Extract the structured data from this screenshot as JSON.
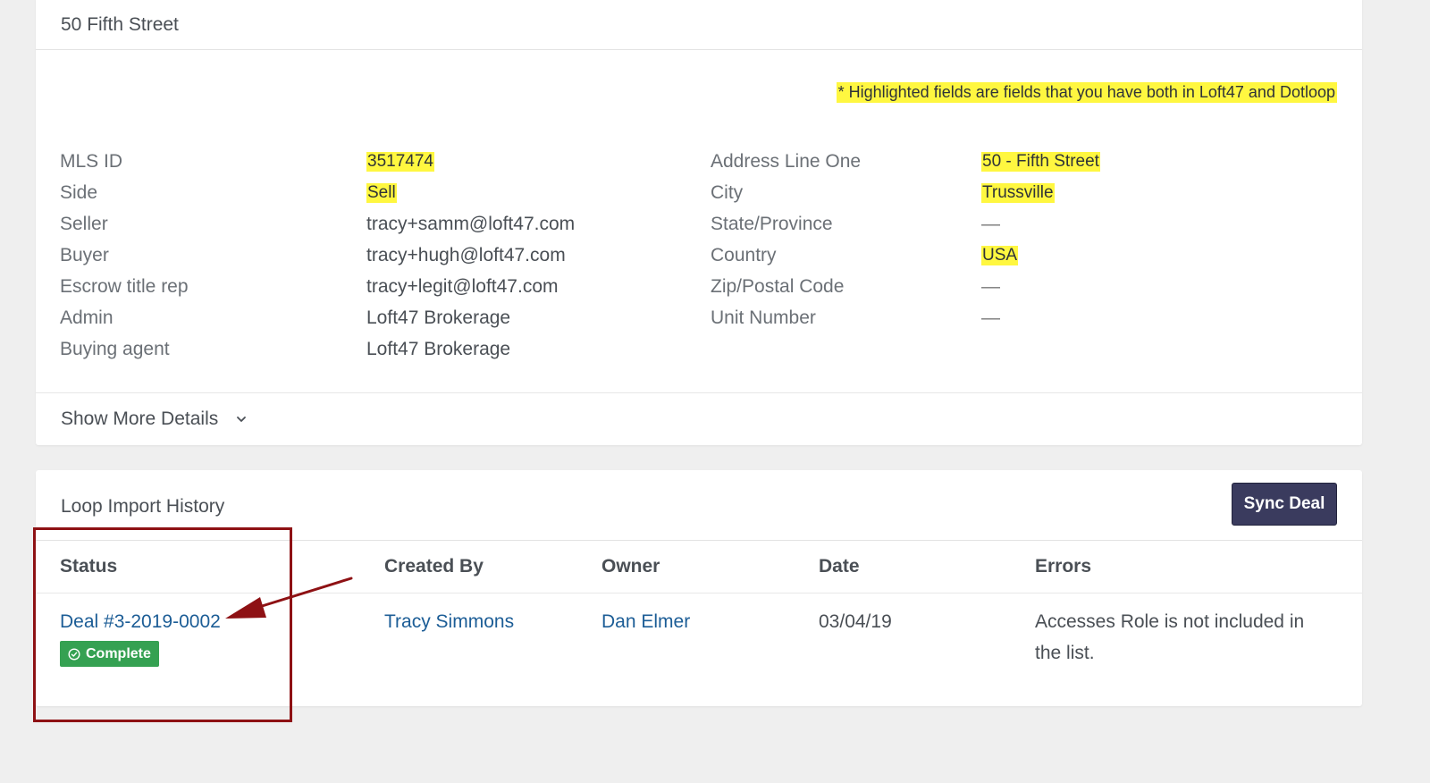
{
  "property": {
    "title": "50 Fifth Street",
    "note": "* Highlighted fields are fields that you have both in Loft47 and Dotloop",
    "left_fields": [
      {
        "label": "MLS ID",
        "value": "3517474",
        "highlighted": true
      },
      {
        "label": "Side",
        "value": "Sell",
        "highlighted": true
      },
      {
        "label": "Seller",
        "value": "tracy+samm@loft47.com",
        "highlighted": false
      },
      {
        "label": "Buyer",
        "value": "tracy+hugh@loft47.com",
        "highlighted": false
      },
      {
        "label": "Escrow title rep",
        "value": "tracy+legit@loft47.com",
        "highlighted": false
      },
      {
        "label": "Admin",
        "value": "Loft47 Brokerage",
        "highlighted": false
      },
      {
        "label": "Buying agent",
        "value": "Loft47 Brokerage",
        "highlighted": false
      }
    ],
    "right_fields": [
      {
        "label": "Address Line One",
        "value": "50 - Fifth Street",
        "highlighted": true
      },
      {
        "label": "City",
        "value": "Trussville",
        "highlighted": true
      },
      {
        "label": "State/Province",
        "value": "—",
        "highlighted": false
      },
      {
        "label": "Country",
        "value": "USA",
        "highlighted": true
      },
      {
        "label": "Zip/Postal Code",
        "value": "—",
        "highlighted": false
      },
      {
        "label": "Unit Number",
        "value": "—",
        "highlighted": false
      }
    ],
    "show_more_label": "Show More Details",
    "show_more_icon": "chevron-down-icon"
  },
  "history": {
    "title": "Loop Import History",
    "sync_label": "Sync Deal",
    "columns": {
      "status": "Status",
      "created_by": "Created By",
      "owner": "Owner",
      "date": "Date",
      "errors": "Errors"
    },
    "rows": [
      {
        "deal": "Deal #3-2019-0002",
        "status_badge": "Complete",
        "status_icon": "check-circle-icon",
        "created_by": "Tracy Simmons",
        "owner": "Dan Elmer",
        "date": "03/04/19",
        "errors": "Accesses Role is not included in the list."
      }
    ]
  },
  "colors": {
    "highlight": "#fff740",
    "link": "#1c5d96",
    "badge_green": "#35a152",
    "button": "#3a3b5e",
    "annotation": "#8e1114"
  }
}
